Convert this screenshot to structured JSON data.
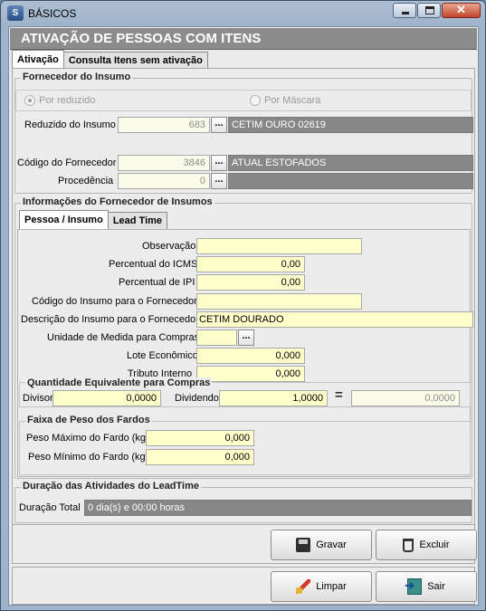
{
  "window": {
    "title": "BÁSICOS",
    "app_icon_text": "S"
  },
  "header": {
    "title": "ATIVAÇÃO DE PESSOAS COM ITENS"
  },
  "main_tabs": [
    {
      "label": "Ativação"
    },
    {
      "label": "Consulta Itens sem ativação"
    }
  ],
  "fornecedor_insumo": {
    "title": "Fornecedor do Insumo",
    "radio_reduzido": "Por reduzido",
    "radio_mascara": "Por Máscara",
    "reduzido_label": "Reduzido do Insumo",
    "reduzido_value": "683",
    "reduzido_desc": "CETIM OURO   02619",
    "codigo_label": "Código do Fornecedor",
    "codigo_value": "3846",
    "codigo_desc": "ATUAL ESTOFADOS",
    "procedencia_label": "Procedência",
    "procedencia_value": "0",
    "procedencia_desc": ""
  },
  "informacoes": {
    "title": "Informações do Fornecedor de Insumos",
    "tabs": [
      {
        "label": "Pessoa / Insumo"
      },
      {
        "label": "Lead Time"
      }
    ],
    "observacao_label": "Observação",
    "observacao_value": "",
    "icms_label": "Percentual do ICMS",
    "icms_value": "0,00",
    "ipi_label": "Percentual de IPI",
    "ipi_value": "0,00",
    "codigo_insumo_label": "Código do Insumo para o Fornecedor",
    "codigo_insumo_value": "",
    "descricao_label": "Descrição do Insumo para o Fornecedor",
    "descricao_value": "CETIM DOURADO",
    "unidade_label": "Unidade de Medida para Compras",
    "unidade_value": "",
    "lote_label": "Lote Econômico",
    "lote_value": "0,000",
    "tributo_label": "Tributo Interno",
    "tributo_value": "0,000"
  },
  "quantidade": {
    "title": "Quantidade Equivalente para Compras",
    "divisor_label": "Divisor",
    "divisor_value": "0,0000",
    "dividendo_label": "Dividendo",
    "dividendo_value": "1,0000",
    "equals": "=",
    "result_value": "0,0000"
  },
  "peso": {
    "title": "Faixa de Peso dos Fardos",
    "max_label": "Peso Máximo do Fardo (kg)",
    "max_value": "0,000",
    "min_label": "Peso Mínimo do Fardo (kg)",
    "min_value": "0,000"
  },
  "duracao": {
    "title": "Duração das Atividades do LeadTime",
    "total_label": "Duração Total",
    "total_value": "0 dia(s) e 00:00 horas"
  },
  "buttons": {
    "gravar": "Gravar",
    "excluir": "Excluir",
    "limpar": "Limpar",
    "sair": "Sair"
  }
}
